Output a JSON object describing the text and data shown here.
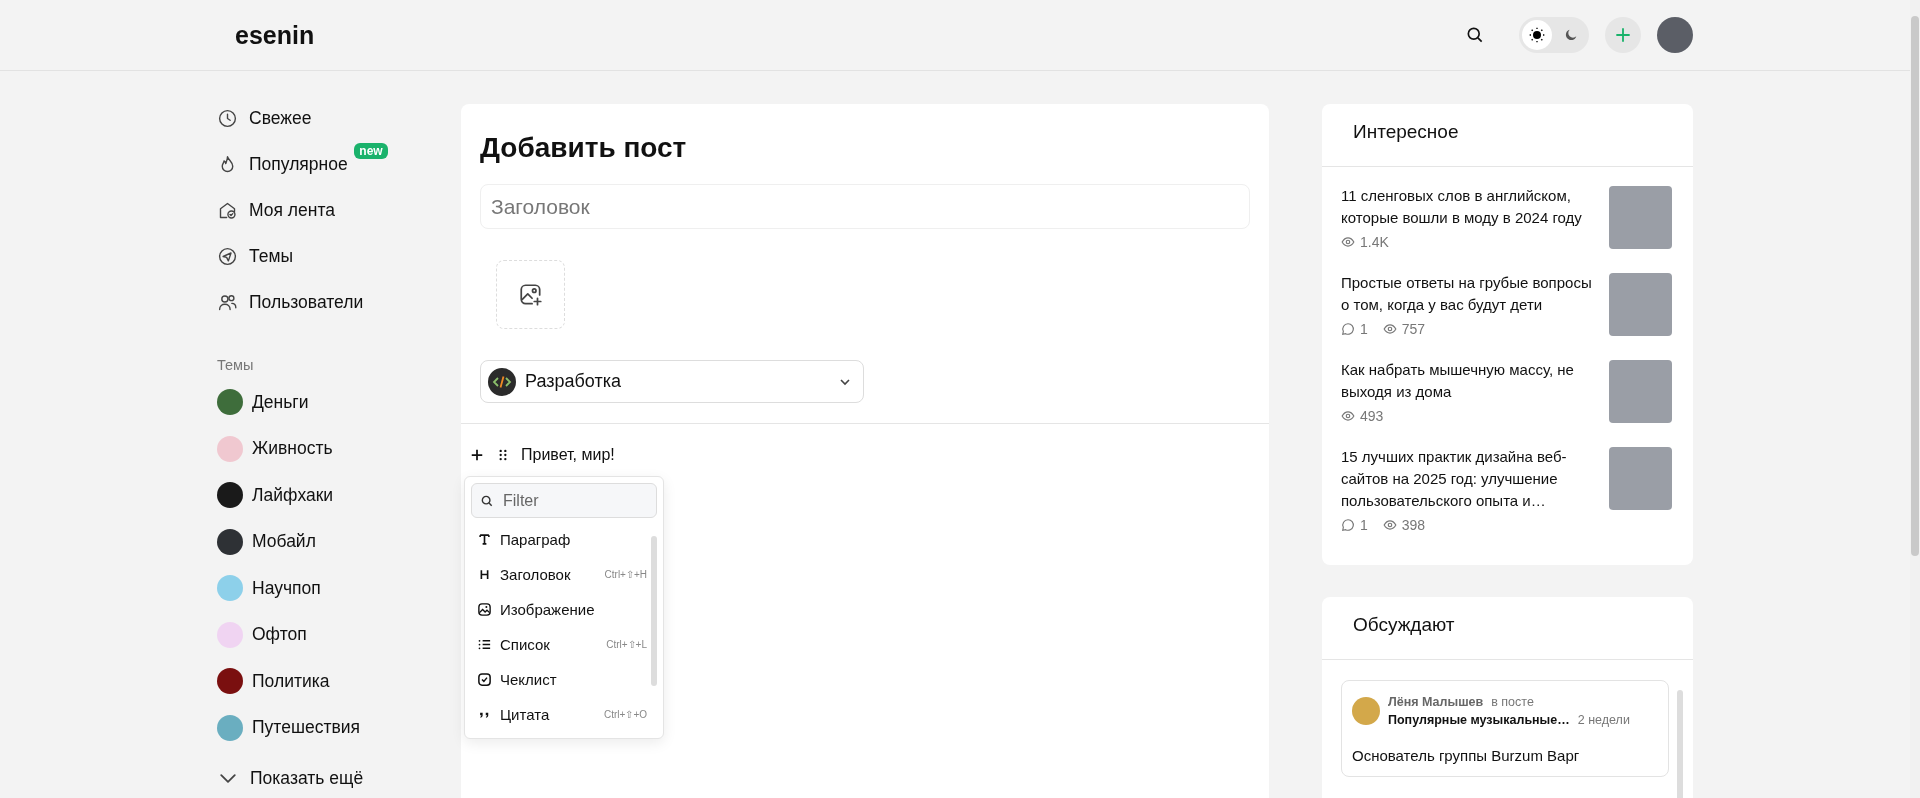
{
  "header": {
    "logo": "esenin",
    "theme_toggle": [
      {
        "kind": "light",
        "selected": true
      },
      {
        "kind": "dark",
        "selected": false
      }
    ]
  },
  "sidebar": {
    "nav": [
      {
        "kind": "clock",
        "label": "Свежее"
      },
      {
        "kind": "flame",
        "label": "Популярное",
        "badge": "new"
      },
      {
        "kind": "feed",
        "label": "Моя лента"
      },
      {
        "kind": "send",
        "label": "Темы"
      },
      {
        "kind": "users",
        "label": "Пользователи"
      }
    ],
    "topics_heading": "Темы",
    "topics": [
      {
        "label": "Деньги",
        "color": "#3e6d3b"
      },
      {
        "label": "Живность",
        "color": "#f0c8d0"
      },
      {
        "label": "Лайфхаки",
        "color": "#1a1a1a"
      },
      {
        "label": "Мобайл",
        "color": "#2e3135"
      },
      {
        "label": "Научпоп",
        "color": "#8dd0ea"
      },
      {
        "label": "Офтоп",
        "color": "#f0d4f2"
      },
      {
        "label": "Политика",
        "color": "#7a0f0f"
      },
      {
        "label": "Путешествия",
        "color": "#6aaec0"
      }
    ],
    "show_more": "Показать ещё"
  },
  "editor": {
    "title": "Добавить пост",
    "title_field": {
      "placeholder": "Заголовок"
    },
    "topic_select": {
      "value": "Разработка"
    },
    "block_text": "Привет, мир!",
    "block_menu": {
      "filter": {
        "placeholder": "Filter"
      },
      "items": [
        {
          "kind": "paragraph",
          "label": "Параграф"
        },
        {
          "kind": "heading",
          "label": "Заголовок",
          "shortcut": "Ctrl+⇧+H"
        },
        {
          "kind": "image",
          "label": "Изображение"
        },
        {
          "kind": "list",
          "label": "Список",
          "shortcut": "Ctrl+⇧+L"
        },
        {
          "kind": "checklist",
          "label": "Чеклист"
        },
        {
          "kind": "quote",
          "label": "Цитата",
          "shortcut": "Ctrl+⇧+O"
        }
      ]
    }
  },
  "interesting": {
    "title": "Интересное",
    "posts": [
      {
        "title": "11 сленговых слов в английском, которые вошли в моду в 2024 году",
        "views": "1.4K"
      },
      {
        "title": "Простые ответы на грубые вопросы о том, когда у вас будут дети",
        "comments": "1",
        "views": "757"
      },
      {
        "title": "Как набрать мышечную массу, не выходя из дома",
        "views": "493"
      },
      {
        "title": "15 лучших практик дизайна веб-сайтов на 2025 год: улучшение пользовательского опыта и…",
        "comments": "1",
        "views": "398"
      }
    ]
  },
  "discussed": {
    "title": "Обсуждают",
    "comments": [
      {
        "author": "Лёня Малышев",
        "context": "в посте",
        "post": "Популярные музыкальные…",
        "time": "2 недели",
        "text": "Основатель группы Burzum Варг"
      }
    ]
  }
}
